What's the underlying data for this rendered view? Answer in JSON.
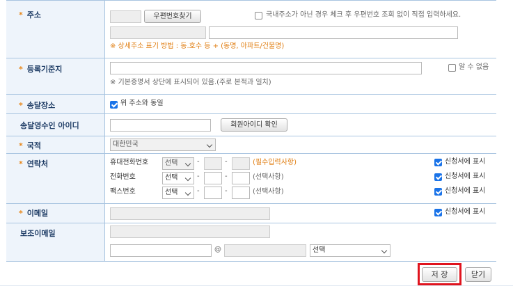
{
  "address": {
    "label": "주소",
    "zip_button": "우편번호찾기",
    "foreign_checkbox_label": "국내주소가 아닌 경우 체크 후 우편번호 조회 없이 직접 입력하세요.",
    "foreign_checked": false,
    "hint": "※ 상세주소 표기 방법 : 동.호수 등 + (동명, 아파트/건물명)"
  },
  "registry_address": {
    "label": "등록기준지",
    "unknown_label": "알 수 없음",
    "unknown_checked": false,
    "hint": "※ 기본증명서 상단에 표시되어 있음.(주로 본적과 일치)"
  },
  "delivery_place": {
    "label": "송달장소",
    "same_label": "위 주소와 동일",
    "same_checked": true
  },
  "delivery_recipient": {
    "label": "송달영수인 아이디",
    "check_button": "회원아이디 확인"
  },
  "nationality": {
    "label": "국적",
    "value": "대한민국"
  },
  "contact": {
    "label": "연락처",
    "rows": [
      {
        "name": "휴대전화번호",
        "select": "선택",
        "note": "(필수입력사항)",
        "note_required": true,
        "show_label": "신청서에 표시",
        "show_checked": true
      },
      {
        "name": "전화번호",
        "select": "선택",
        "note": "(선택사항)",
        "note_required": false,
        "show_label": "신청서에 표시",
        "show_checked": true
      },
      {
        "name": "팩스번호",
        "select": "선택",
        "note": "(선택사항)",
        "note_required": false,
        "show_label": "신청서에 표시",
        "show_checked": true
      }
    ],
    "dash": "-"
  },
  "email": {
    "label": "이메일",
    "show_label": "신청서에 표시",
    "show_checked": true
  },
  "sub_email": {
    "label": "보조이메일",
    "at": "@",
    "domain_select": "선택"
  },
  "footer": {
    "save": "저 장",
    "close": "닫기"
  },
  "colors": {
    "label_bg": "#eef4fb",
    "border": "#a8c4e0",
    "required_star": "#e8881c",
    "highlight": "#e0141e",
    "checkbox": "#1a73e8"
  }
}
